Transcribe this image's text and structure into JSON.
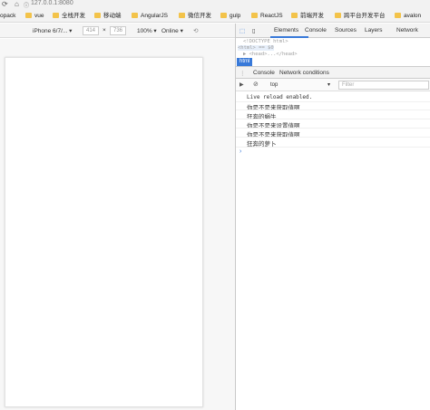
{
  "browser": {
    "url": "127.0.0.1:8080"
  },
  "bookmarks": [
    {
      "label": "opack"
    },
    {
      "label": "vue"
    },
    {
      "label": "全栈开发"
    },
    {
      "label": "移动端"
    },
    {
      "label": "AngularJS"
    },
    {
      "label": "微信开发"
    },
    {
      "label": "gulp"
    },
    {
      "label": "ReactJS"
    },
    {
      "label": "前端开发"
    },
    {
      "label": "跨平台开发平台"
    },
    {
      "label": "avalon"
    }
  ],
  "device_toolbar": {
    "device": "iPhone 6/7/...",
    "width": "414",
    "times": "×",
    "height": "736",
    "zoom": "100%",
    "network": "Online"
  },
  "devtools": {
    "tabs": [
      "Elements",
      "Console",
      "Sources",
      "Layers",
      "Network"
    ],
    "active_tab": "Elements",
    "elements_lines": [
      "<!DOCTYPE html>",
      "<html> == $0",
      "▶ <head>...</head>"
    ],
    "breadcrumb": "html",
    "drawer_tabs": [
      "Console",
      "Network conditions"
    ],
    "context": "top",
    "filter_placeholder": "Filter",
    "console_lines": [
      "Live reload enabled.",
      "你是不是来获取值啊",
      "狂奔的蜗牛",
      "你是不是来设置值啊",
      "你是不是来获取值啊",
      "狂奔的萝卜"
    ],
    "prompt": "›"
  }
}
